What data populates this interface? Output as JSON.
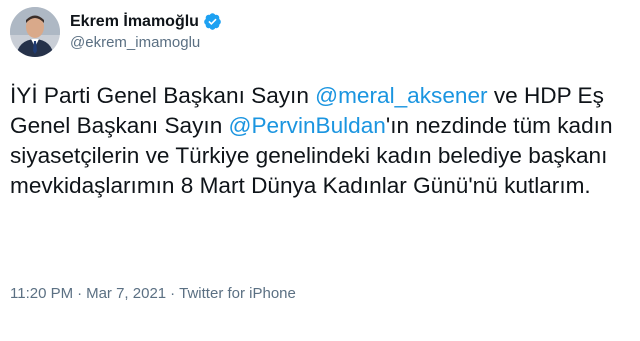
{
  "author": {
    "display_name": "Ekrem İmamoğlu",
    "handle": "@ekrem_imamoglu",
    "avatar_icon": "profile-photo-avatar",
    "verified_icon": "verified-badge-icon",
    "verified_color": "#1da1f2"
  },
  "tweet": {
    "seg1": "İYİ Parti Genel Başkanı Sayın ",
    "mention1": "@meral_aksener",
    "seg2": " ve HDP Eş Genel Başkanı Sayın ",
    "mention2": "@PervinBuldan",
    "seg3": "'ın nezdinde tüm kadın siyasetçilerin ve Türkiye genelindeki kadın belediye başkanı mevkidaşlarımın 8 Mart Dünya Kadınlar Günü'nü kutlarım."
  },
  "meta": {
    "time": "11:20 PM",
    "separator": "·",
    "date": "Mar 7, 2021",
    "source": "Twitter for iPhone"
  },
  "colors": {
    "text": "#0f1419",
    "secondary": "#5b7083",
    "mention": "#1b95e0"
  }
}
